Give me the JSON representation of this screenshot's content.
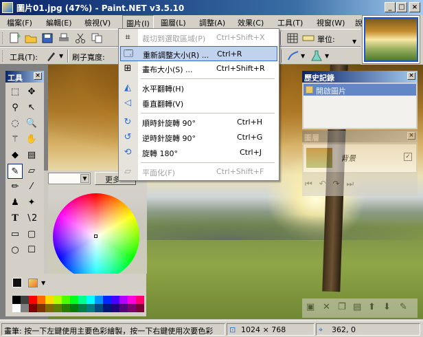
{
  "window": {
    "title": "圖片01.jpg (47%) - Paint.NET v3.5.10",
    "controls": {
      "minimize": "_",
      "maximize": "□",
      "close": "×"
    }
  },
  "menubar": [
    {
      "label": "檔案(F)"
    },
    {
      "label": "編輯(E)"
    },
    {
      "label": "檢視(V)"
    },
    {
      "label": "圖片(I)",
      "active": true
    },
    {
      "label": "圖層(L)"
    },
    {
      "label": "調整(A)"
    },
    {
      "label": "效果(C)"
    },
    {
      "label": "工具(T)"
    },
    {
      "label": "視窗(W)"
    },
    {
      "label": "說"
    }
  ],
  "toolbar1": {
    "units_label": "單位:"
  },
  "toolbar2": {
    "tool_label": "工具(T):",
    "brush_width_label": "刷子寬度:"
  },
  "image_menu": {
    "items": [
      {
        "label": "裁切到選取區域(P)",
        "shortcut": "Ctrl+Shift+X",
        "disabled": true,
        "icon": "crop-icon"
      },
      {
        "label": "重新調整大小(R) ...",
        "shortcut": "Ctrl+R",
        "highlighted": true,
        "icon": "resize-icon"
      },
      {
        "label": "畫布大小(S) ...",
        "shortcut": "Ctrl+Shift+R",
        "icon": "canvas-size-icon"
      },
      {
        "label": "水平翻轉(H)",
        "shortcut": "",
        "icon": "flip-horizontal-icon"
      },
      {
        "label": "垂直翻轉(V)",
        "shortcut": "",
        "icon": "flip-vertical-icon"
      },
      {
        "label": "順時針旋轉 90°",
        "shortcut": "Ctrl+H",
        "icon": "rotate-cw-icon"
      },
      {
        "label": "逆時針旋轉 90°",
        "shortcut": "Ctrl+G",
        "icon": "rotate-ccw-icon"
      },
      {
        "label": "旋轉 180°",
        "shortcut": "Ctrl+J",
        "icon": "rotate-180-icon"
      },
      {
        "label": "平面化(F)",
        "shortcut": "Ctrl+Shift+F",
        "disabled": true,
        "icon": "flatten-icon"
      }
    ]
  },
  "tools_panel": {
    "title": "工具"
  },
  "history_panel": {
    "title": "歷史記錄",
    "items": [
      "開啟圖片"
    ]
  },
  "layers_panel": {
    "title": "圖層",
    "layer_name": "背景"
  },
  "colors_panel": {
    "more_button": "更多"
  },
  "statusbar": {
    "hint": "畫筆: 按一下左鍵使用主要色彩繪製，按一下右鍵使用次要色彩",
    "image_size": "1024 × 768",
    "cursor_position": "362, 0"
  },
  "colors": {
    "accent": "#0a246a",
    "menu_highlight": "#c1d2ee",
    "menu_highlight_border": "#316ac5"
  },
  "palette": [
    "#000000",
    "#404040",
    "#ff0000",
    "#ff6a00",
    "#ffd800",
    "#b6ff00",
    "#4cff00",
    "#00ff21",
    "#00ff90",
    "#00ffff",
    "#0094ff",
    "#0026ff",
    "#4800ff",
    "#b200ff",
    "#ff00dc",
    "#ff006e",
    "#ffffff",
    "#808080",
    "#7f0000",
    "#7f3300",
    "#7f6a00",
    "#5b7f00",
    "#267f00",
    "#007f0e",
    "#007f46",
    "#007f7f",
    "#004a7f",
    "#00137f",
    "#21007f",
    "#57007f",
    "#7f006e",
    "#7f0037"
  ]
}
